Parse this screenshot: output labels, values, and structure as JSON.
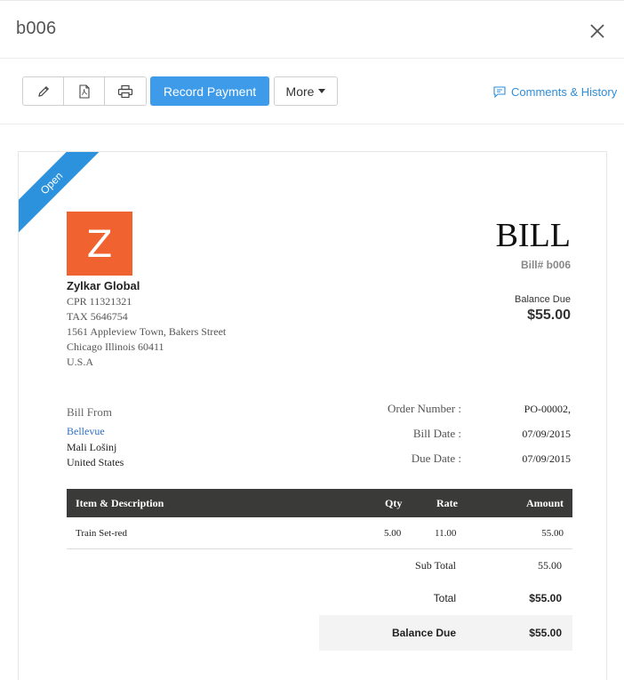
{
  "header": {
    "title": "b006"
  },
  "toolbar": {
    "record_payment": "Record Payment",
    "more": "More",
    "comments_history": "Comments & History"
  },
  "bill": {
    "status": "Open",
    "logo_letter": "Z",
    "company_name": "Zylkar Global",
    "address_lines": [
      "CPR 11321321",
      "TAX 5646754",
      "1561 Appleview Town, Bakers Street",
      "Chicago Illinois 60411",
      "U.S.A"
    ],
    "doc_title": "BILL",
    "bill_number": "Bill# b006",
    "balance_due_label": "Balance Due",
    "balance_due_amount": "$55.00",
    "bill_from_label": "Bill From",
    "vendor_name": "Bellevue",
    "vendor_lines": [
      "Mali Lošinj",
      "United States"
    ],
    "meta": [
      {
        "label": "Order Number :",
        "value": "PO-00002,"
      },
      {
        "label": "Bill Date :",
        "value": "07/09/2015"
      },
      {
        "label": "Due Date :",
        "value": "07/09/2015"
      }
    ],
    "table": {
      "headers": [
        "Item & Description",
        "Qty",
        "Rate",
        "Amount"
      ],
      "rows": [
        {
          "item": "Train Set-red",
          "qty": "5.00",
          "rate": "11.00",
          "amount": "55.00"
        }
      ]
    },
    "totals": {
      "sub_total_label": "Sub Total",
      "sub_total_value": "55.00",
      "total_label": "Total",
      "total_value": "$55.00",
      "balance_due_label": "Balance Due",
      "balance_due_value": "$55.00"
    }
  },
  "colors": {
    "accent": "#3d9be9",
    "ribbon": "#2d92dd",
    "logo": "#f0622f",
    "table_header": "#3a3a38",
    "link": "#2f8ed8"
  }
}
